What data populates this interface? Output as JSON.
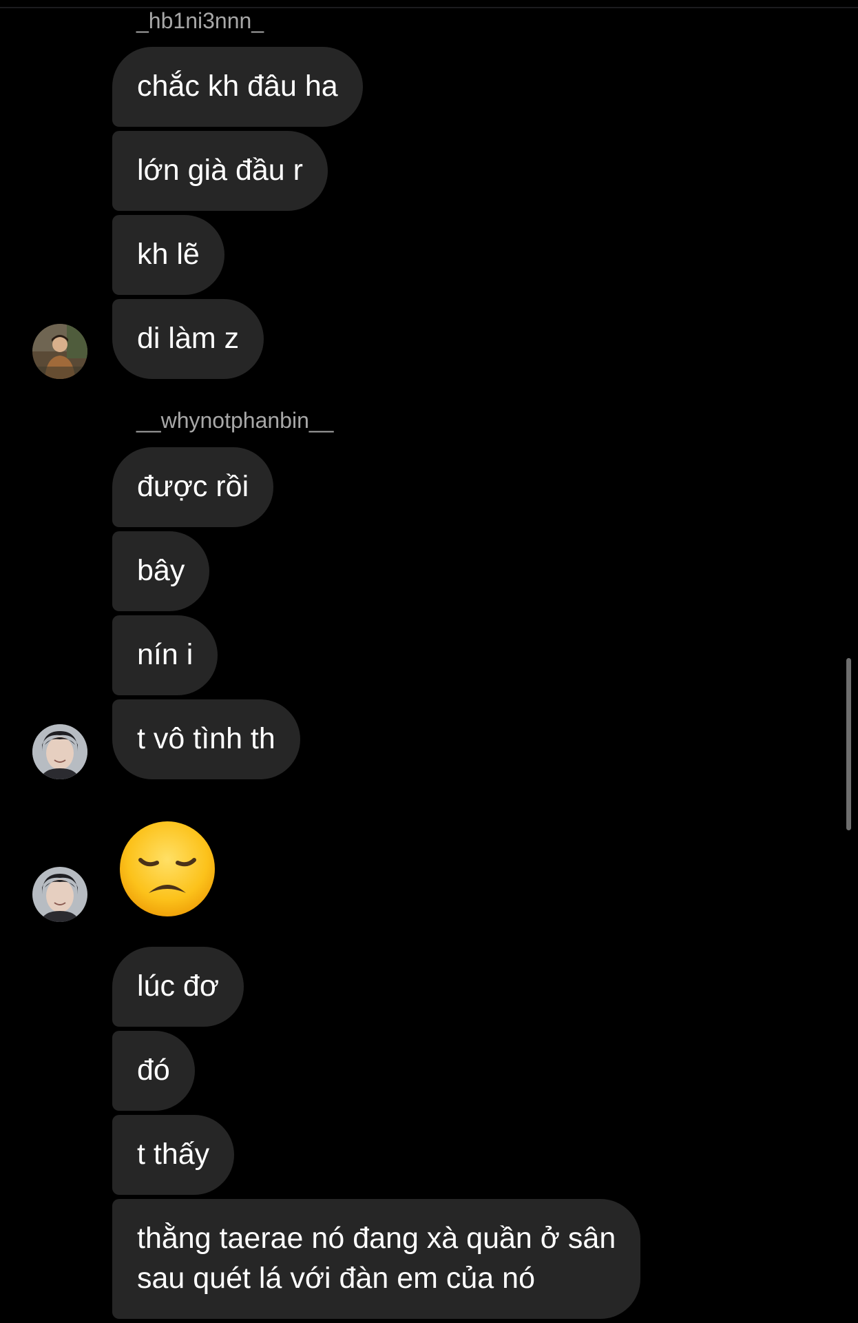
{
  "thread": {
    "groups": [
      {
        "sender": "_hb1ni3nnn_",
        "messages": [
          "chắc kh đâu ha",
          "lớn già đầu r",
          "kh lẽ",
          "di làm z"
        ]
      },
      {
        "sender": "__whynotphanbin__",
        "messages": [
          "được rồi",
          "bây",
          "nín i",
          "t vô tình th"
        ]
      },
      {
        "sender": "",
        "emoji": "disappointed-face-emoji"
      },
      {
        "sender": "",
        "messages": [
          "lúc đơ",
          "đó",
          "t thấy",
          "thằng taerae nó đang xà quần ở sân\nsau quét lá với đàn em của nó"
        ]
      }
    ]
  },
  "colors": {
    "background": "#000000",
    "bubble": "#262626",
    "text": "#ffffff",
    "sender_name": "#a8a8a8",
    "scrollbar": "#6e6e6e"
  }
}
